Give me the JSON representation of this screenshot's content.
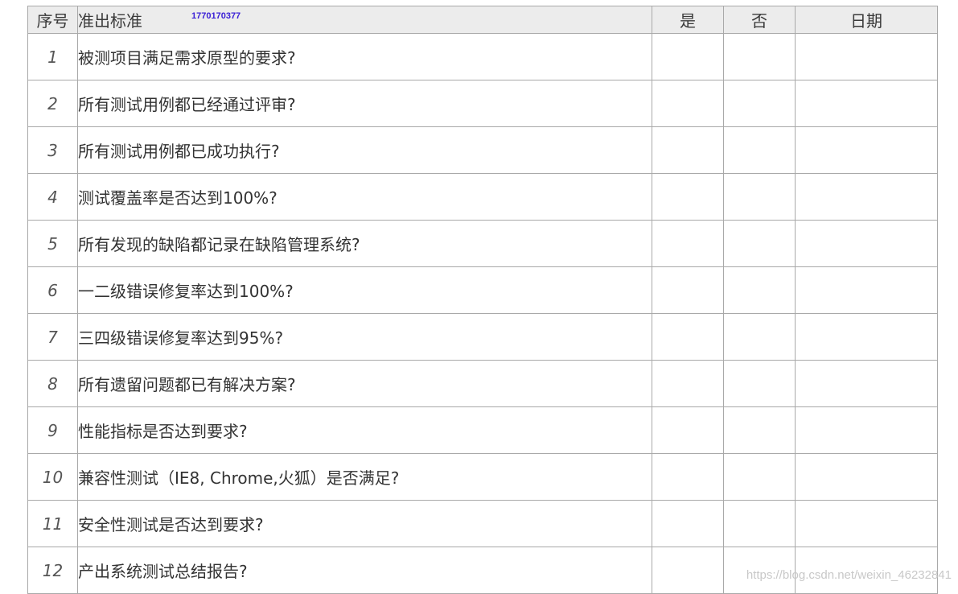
{
  "header": {
    "seq": "序号",
    "criteria": "准出标准",
    "stamp": "1770170377",
    "yes": "是",
    "no": "否",
    "date": "日期"
  },
  "rows": [
    {
      "seq": "1",
      "text": "被测项目满足需求原型的要求?"
    },
    {
      "seq": "2",
      "text": "所有测试用例都已经通过评审?"
    },
    {
      "seq": "3",
      "text": "所有测试用例都已成功执行?"
    },
    {
      "seq": "4",
      "text": "测试覆盖率是否达到100%?"
    },
    {
      "seq": "5",
      "text": "所有发现的缺陷都记录在缺陷管理系统?"
    },
    {
      "seq": "6",
      "text": "一二级错误修复率达到100%?"
    },
    {
      "seq": "7",
      "text": "三四级错误修复率达到95%?"
    },
    {
      "seq": "8",
      "text": "所有遗留问题都已有解决方案?"
    },
    {
      "seq": "9",
      "text": "性能指标是否达到要求?"
    },
    {
      "seq": "10",
      "text": "兼容性测试（IE8, Chrome,火狐）是否满足?"
    },
    {
      "seq": "11",
      "text": "安全性测试是否达到要求?"
    },
    {
      "seq": "12",
      "text": "产出系统测试总结报告?"
    }
  ],
  "watermark": "https://blog.csdn.net/weixin_46232841"
}
